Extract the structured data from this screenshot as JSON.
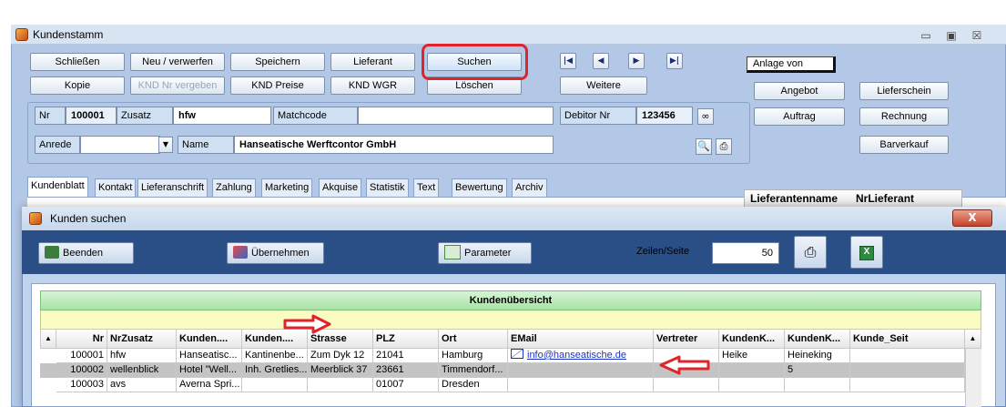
{
  "window": {
    "title": "Kundenstamm",
    "controls": [
      "▭",
      "▣",
      "☒"
    ]
  },
  "toolbar": {
    "schliessen": "Schließen",
    "neu_verwerfen": "Neu / verwerfen",
    "speichern": "Speichern",
    "lieferant": "Lieferant",
    "suchen": "Suchen",
    "kopie": "Kopie",
    "knd_nr_vergeben": "KND Nr vergeben",
    "knd_preise": "KND Preise",
    "knd_wgr": "KND WGR",
    "loeschen": "Löschen",
    "weitere": "Weitere",
    "nav": [
      "|◀",
      "◀",
      "▶",
      "▶|"
    ]
  },
  "right_panel": {
    "anlage_label": "Anlage von",
    "angebot": "Angebot",
    "lieferschein": "Lieferschein",
    "auftrag": "Auftrag",
    "rechnung": "Rechnung",
    "barverkauf": "Barverkauf"
  },
  "form": {
    "nr_label": "Nr",
    "nr_value": "100001",
    "zusatz_label": "Zusatz",
    "zusatz_value": "hfw",
    "matchcode_label": "Matchcode",
    "matchcode_value": "",
    "debitor_label": "Debitor Nr",
    "debitor_value": "123456",
    "anrede_label": "Anrede",
    "anrede_value": "",
    "name_label": "Name",
    "name_value": "Hanseatische Werftcontor GmbH"
  },
  "tabs": [
    "Kundenblatt",
    "Kontakt",
    "Lieferanschrift",
    "Zahlung",
    "Marketing",
    "Akquise",
    "Statistik",
    "Text",
    "Bewertung",
    "Archiv"
  ],
  "side_table_headers": [
    "Lieferantenname",
    "NrLieferant"
  ],
  "dialog": {
    "title": "Kunden suchen",
    "close": "X",
    "beenden": "Beenden",
    "uebernehmen": "Übernehmen",
    "parameter": "Parameter",
    "zeilen_label": "Zeilen/Seite",
    "zeilen_value": "50"
  },
  "grid": {
    "caption": "Kundenübersicht",
    "columns": [
      "Nr",
      "NrZusatz",
      "Kunden....",
      "Kunden....",
      "Strasse",
      "PLZ",
      "Ort",
      "EMail",
      "Vertreter",
      "KundenK...",
      "KundenK...",
      "Kunde_Seit"
    ],
    "rows": [
      [
        "100001",
        "hfw",
        "Hanseatisc...",
        "Kantinenbe...",
        "Zum Dyk 12",
        "21041",
        "Hamburg",
        "info@hanseatische.de",
        "",
        "Heike",
        "Heineking",
        ""
      ],
      [
        "100002",
        "wellenblick",
        "Hotel \"Well...",
        "Inh. Gretlies...",
        "Meerblick 37",
        "23661",
        "Timmendorf...",
        "",
        "",
        "",
        "5",
        ""
      ],
      [
        "100003",
        "avs",
        "Averna Spri...",
        "",
        "",
        "01007",
        "Dresden",
        "",
        "",
        "",
        "",
        ""
      ]
    ]
  },
  "colors": {
    "window_bg": "#b3c8e6",
    "toolbar_dark": "#2a4f86",
    "grid_caption": "#a9e2a4",
    "highlight_red": "#e0242b"
  }
}
